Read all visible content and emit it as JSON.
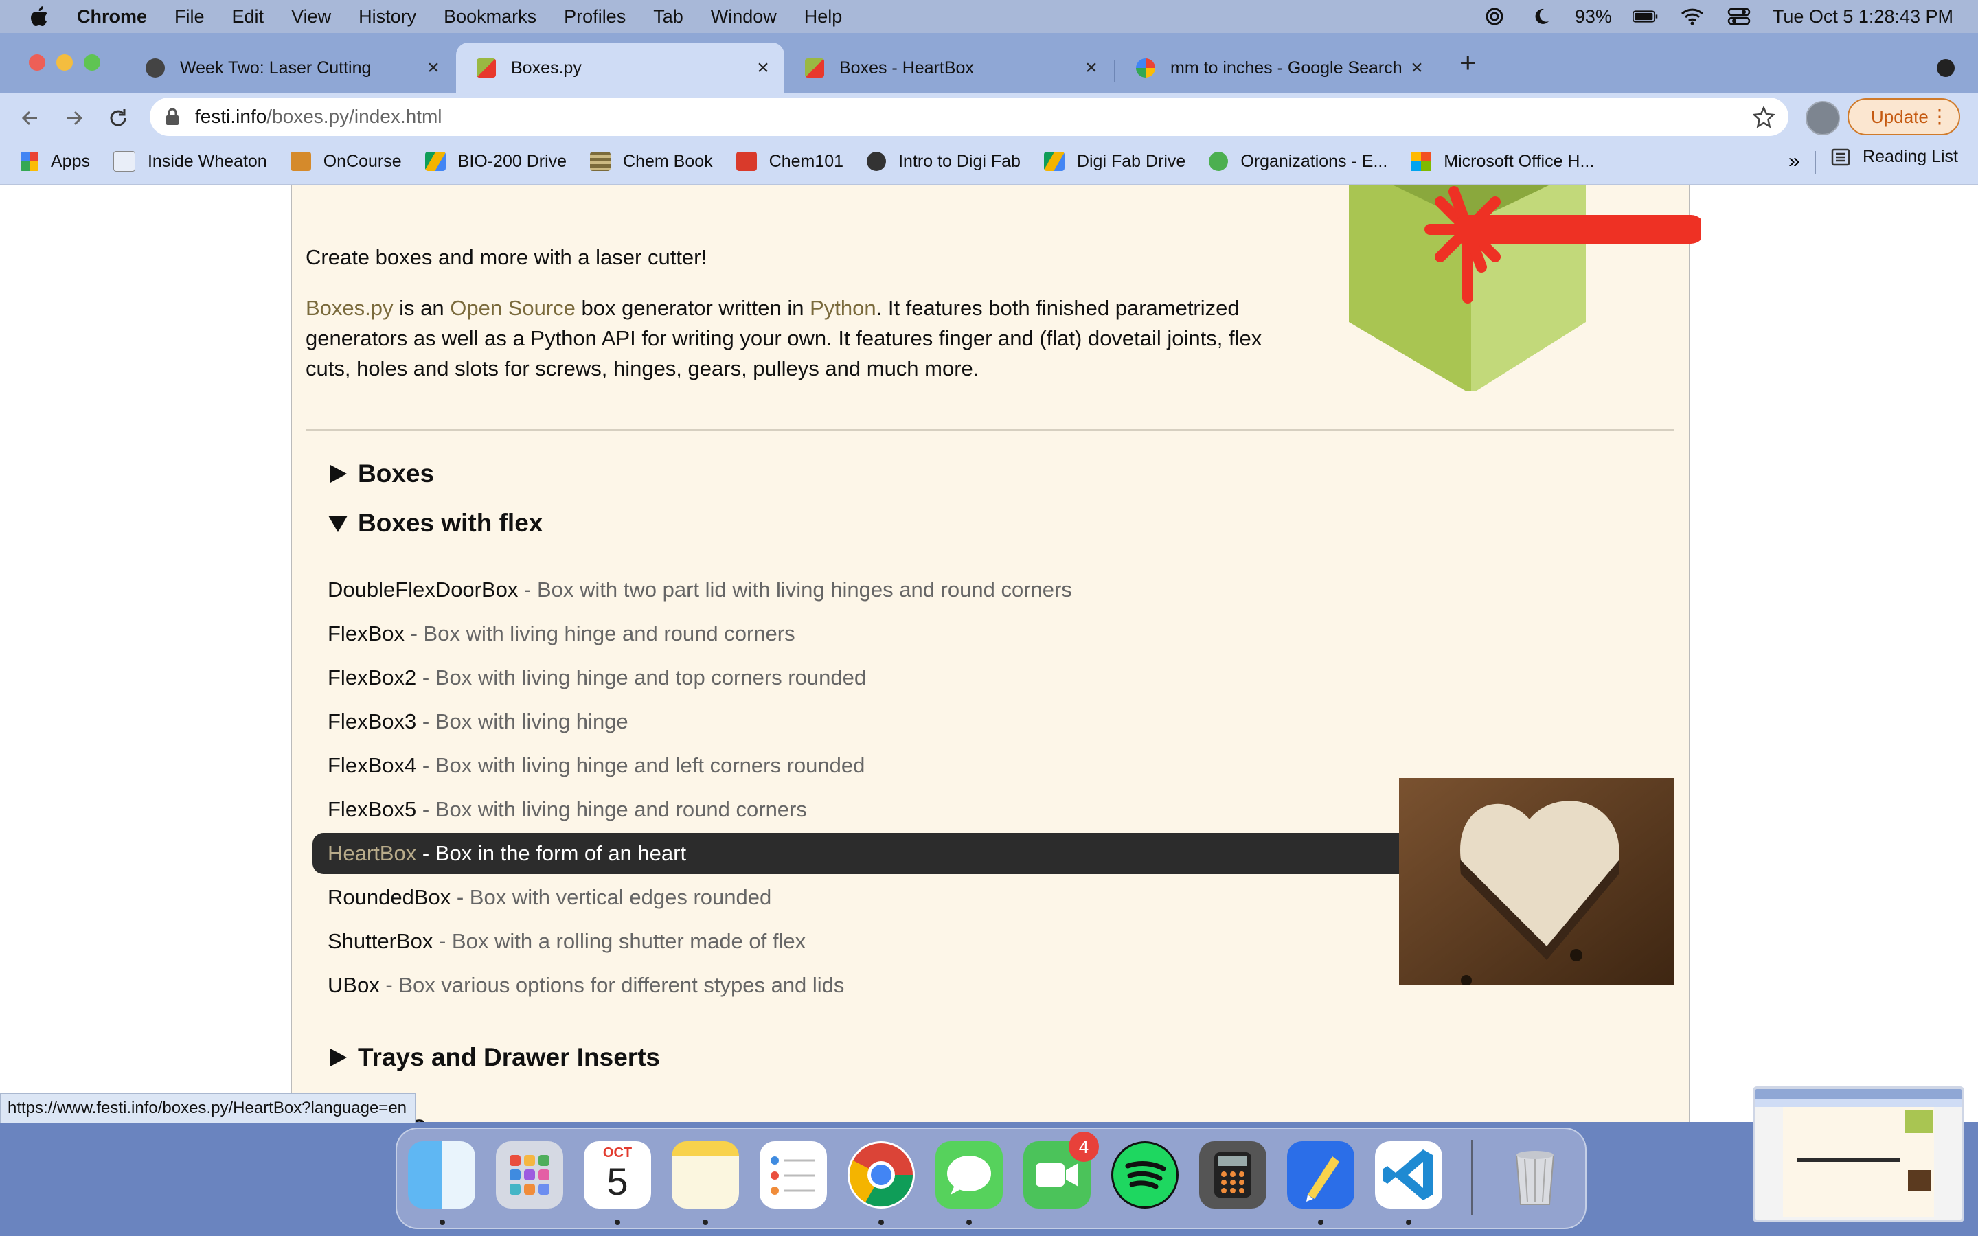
{
  "menubar": {
    "app": "Chrome",
    "items": [
      "File",
      "Edit",
      "View",
      "History",
      "Bookmarks",
      "Profiles",
      "Tab",
      "Window",
      "Help"
    ],
    "battery": "93%",
    "clock": "Tue Oct 5  1:28:43 PM"
  },
  "tabs": [
    {
      "title": "Week Two: Laser Cutting"
    },
    {
      "title": "Boxes.py"
    },
    {
      "title": "Boxes - HeartBox"
    },
    {
      "title": "mm to inches - Google Search"
    }
  ],
  "address": {
    "host": "festi.info",
    "path": "/boxes.py/index.html"
  },
  "update_label": "Update",
  "bookmarks": [
    "Apps",
    "Inside Wheaton",
    "OnCourse",
    "BIO-200 Drive",
    "Chem Book",
    "Chem101",
    "Intro to Digi Fab",
    "Digi Fab Drive",
    "Organizations - E...",
    "Microsoft Office H..."
  ],
  "reading_list": "Reading List",
  "page": {
    "tagline": "Create boxes and more with a laser cutter!",
    "intro": {
      "link1": "Boxes.py",
      "t1": " is an ",
      "link2": "Open Source",
      "t2": " box generator written in ",
      "link3": "Python",
      "t3": ". It features both finished parametrized generators as well as a Python API for writing your own. It features finger and (flat) dovetail joints, flex cuts, holes and slots for screws, hinges, gears, pulleys and much more."
    },
    "sections": {
      "boxes": "Boxes",
      "boxes_with_flex": "Boxes with flex",
      "trays": "Trays and Drawer Inserts",
      "partial": "s"
    },
    "items": [
      {
        "name": "DoubleFlexDoorBox",
        "desc": " - Box with two part lid with living hinges and round corners"
      },
      {
        "name": "FlexBox",
        "desc": " - Box with living hinge and round corners"
      },
      {
        "name": "FlexBox2",
        "desc": " - Box with living hinge and top corners rounded"
      },
      {
        "name": "FlexBox3",
        "desc": " - Box with living hinge"
      },
      {
        "name": "FlexBox4",
        "desc": " - Box with living hinge and left corners rounded"
      },
      {
        "name": "FlexBox5",
        "desc": " - Box with living hinge and round corners"
      },
      {
        "name": "HeartBox",
        "desc": " - Box in the form of an heart"
      },
      {
        "name": "RoundedBox",
        "desc": " - Box with vertical edges rounded"
      },
      {
        "name": "ShutterBox",
        "desc": " - Box with a rolling shutter made of flex"
      },
      {
        "name": "UBox",
        "desc": " - Box various options for different stypes and lids"
      }
    ],
    "hover_url": "https://www.festi.info/boxes.py/HeartBox?language=en"
  },
  "dock": {
    "calendar_month": "OCT",
    "calendar_day": "5",
    "facetime_badge": "4"
  }
}
